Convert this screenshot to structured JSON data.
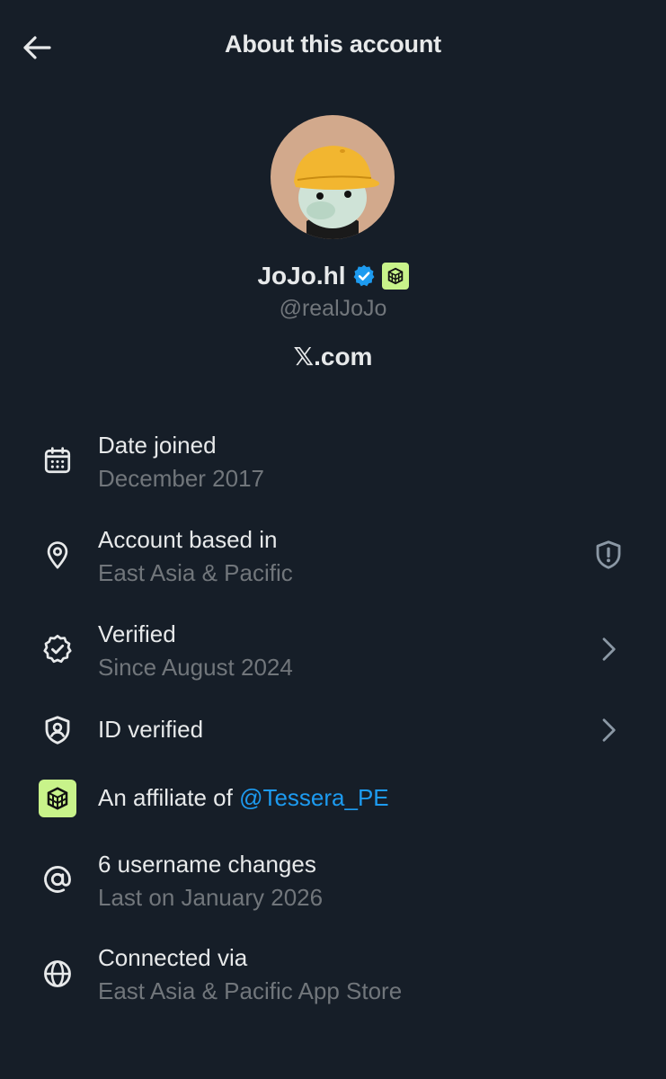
{
  "header": {
    "title": "About this account",
    "back_icon": "arrow-left-icon"
  },
  "profile": {
    "display_name": "JoJo.hl",
    "handle": "@realJoJo",
    "site": "𝕏.com",
    "verified_badge_color": "#1D9BF0",
    "affiliate_badge_color": "#C8F38A"
  },
  "rows": [
    {
      "icon": "calendar-icon",
      "label": "Date joined",
      "sub": "December 2017"
    },
    {
      "icon": "location-pin-icon",
      "label": "Account based in",
      "sub": "East Asia & Pacific",
      "trail_icon": "shield-exclamation-icon"
    },
    {
      "icon": "verified-badge-icon",
      "label": "Verified",
      "sub": "Since August 2024",
      "trail_icon": "chevron-right-icon"
    },
    {
      "icon": "id-shield-icon",
      "label": "ID verified",
      "trail_icon": "chevron-right-icon"
    },
    {
      "icon": "affiliate-cube-icon",
      "label_prefix": "An affiliate of ",
      "label_link": "@Tessera_PE"
    },
    {
      "icon": "at-sign-icon",
      "label": "6 username changes",
      "sub": "Last on January 2026"
    },
    {
      "icon": "globe-icon",
      "label": "Connected via",
      "sub": "East Asia & Pacific App Store"
    }
  ],
  "colors": {
    "background": "#161E28",
    "primary_text": "#E7E9EA",
    "secondary_text": "#71767B",
    "link": "#1D9BF0"
  }
}
